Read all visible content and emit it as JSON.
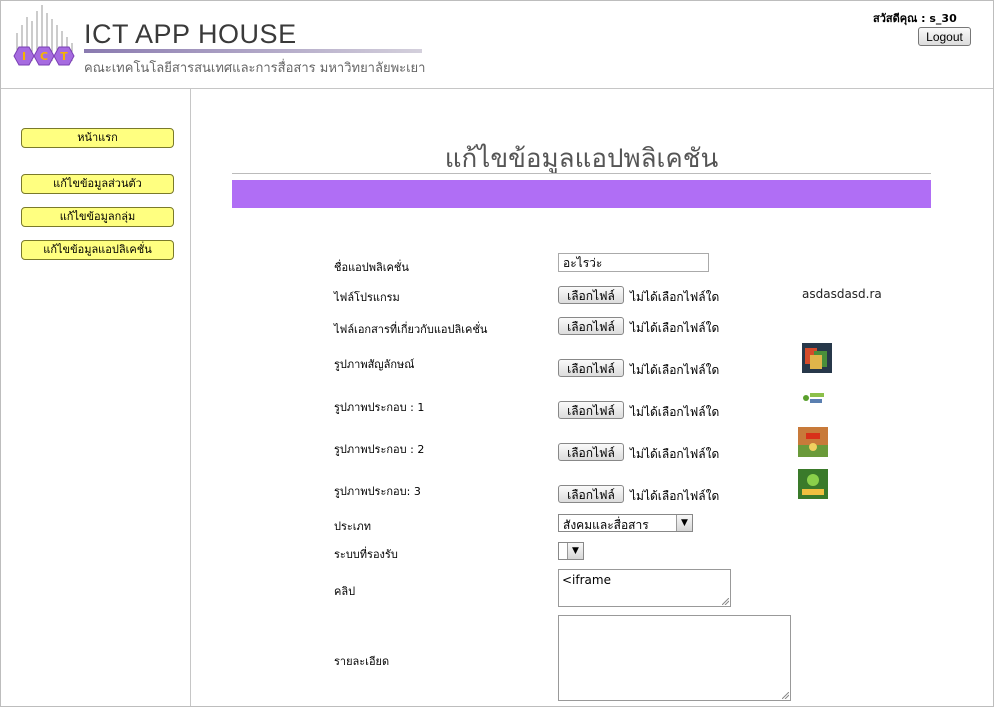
{
  "header": {
    "brand_title": "ICT APP HOUSE",
    "brand_subtitle": "คณะเทคโนโลยีสารสนเทศและการสื่อสาร มหาวิทยาลัยพะเยา",
    "greeting": "สวัสดีคุณ : s_30",
    "logout_label": "Logout",
    "logo_text": "ICT"
  },
  "sidebar": {
    "items": [
      {
        "label": "หน้าแรก"
      },
      {
        "label": "แก้ไขข้อมูลส่วนตัว"
      },
      {
        "label": "แก้ไขข้อมูลกลุ่ม"
      },
      {
        "label": "แก้ไขข้อมูลแอปลิเคชั่น"
      }
    ]
  },
  "main": {
    "title": "แก้ไขข้อมูลแอปพลิเคชัน",
    "accent_color": "#b06ef5"
  },
  "form": {
    "app_name_label": "ชื่อแอปพลิเคชั่น",
    "app_name_value": "อะไรว่ะ",
    "program_file_label": "ไฟล์โปรแกรม",
    "document_file_label": "ไฟล์เอกสารที่เกี่ยวกับแอปลิเคชั่น",
    "icon_label": "รูปภาพสัญลักษณ์",
    "screenshot1_label": "รูปภาพประกอบ : 1",
    "screenshot2_label": "รูปภาพประกอบ : 2",
    "screenshot3_label": "รูปภาพประกอบ: 3",
    "choose_file_label": "เลือกไฟล์",
    "no_file_text": "ไม่ได้เลือกไฟล์ใด",
    "existing_program_file": "asdasdasd.ra",
    "category_label": "ประเภท",
    "category_value": "สังคมและสื่อสาร",
    "platform_label": "ระบบที่รองรับ",
    "platform_value": "",
    "clip_label": "คลิป",
    "clip_value": "<iframe",
    "detail_label": "รายละเอียด",
    "detail_value": ""
  }
}
